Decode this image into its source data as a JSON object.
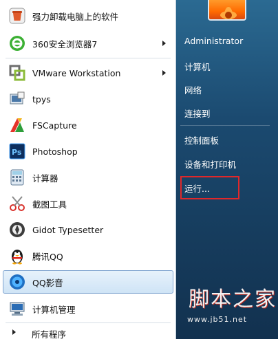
{
  "programs": [
    {
      "name": "强力卸载电脑上的软件",
      "icon": "uninstall-icon",
      "has_submenu": false
    },
    {
      "name": "360安全浏览器7",
      "icon": "360-browser-icon",
      "has_submenu": true
    },
    {
      "name": "VMware Workstation",
      "icon": "vmware-icon",
      "has_submenu": true
    },
    {
      "name": "tpys",
      "icon": "tpys-icon",
      "has_submenu": false
    },
    {
      "name": "FSCapture",
      "icon": "fscapture-icon",
      "has_submenu": false
    },
    {
      "name": "Photoshop",
      "icon": "photoshop-icon",
      "has_submenu": false
    },
    {
      "name": "计算器",
      "icon": "calculator-icon",
      "has_submenu": false
    },
    {
      "name": "截图工具",
      "icon": "snipping-tool-icon",
      "has_submenu": false
    },
    {
      "name": "Gidot Typesetter",
      "icon": "gidot-typesetter-icon",
      "has_submenu": false
    },
    {
      "name": "腾讯QQ",
      "icon": "qq-penguin-icon",
      "has_submenu": false
    },
    {
      "name": "QQ影音",
      "icon": "qq-player-icon",
      "has_submenu": false,
      "selected": true
    },
    {
      "name": "计算机管理",
      "icon": "computer-management-icon",
      "has_submenu": false
    }
  ],
  "all_programs": "所有程序",
  "right_pane": {
    "user": "Administrator",
    "items": [
      "计算机",
      "网络",
      "连接到",
      "控制面板",
      "设备和打印机",
      "运行..."
    ]
  },
  "watermark": {
    "text": "脚本之家",
    "url": "www.jb51.net"
  },
  "colors": {
    "right_pane_bg": "#1b4a70",
    "selection_border": "#7da2ce",
    "highlight_box": "#e0282a"
  }
}
